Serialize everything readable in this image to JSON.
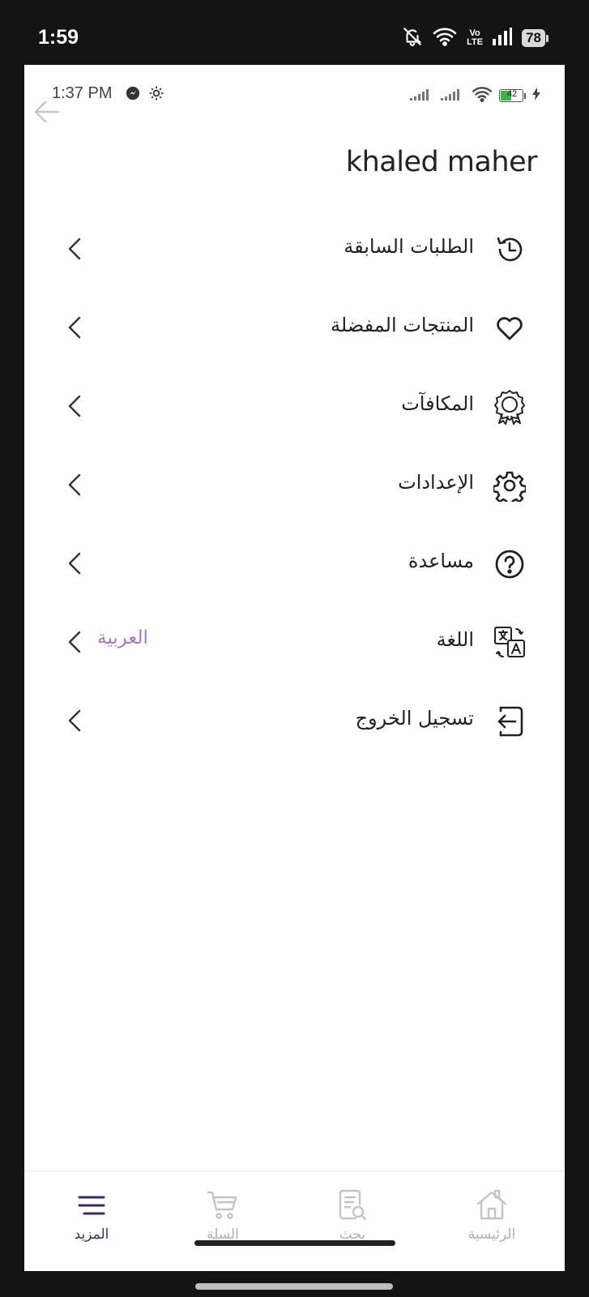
{
  "outer_status": {
    "time": "1:59",
    "network": "Vo\nLTE",
    "battery": "78"
  },
  "inner_status": {
    "time": "1:37 PM",
    "battery": "42"
  },
  "user": {
    "name": "khaled maher"
  },
  "menu": [
    {
      "label": "الطلبات السابقة",
      "icon": "history-icon"
    },
    {
      "label": "المنتجات المفضلة",
      "icon": "heart-icon"
    },
    {
      "label": "المكافآت",
      "icon": "reward-badge-icon"
    },
    {
      "label": "الإعدادات",
      "icon": "gear-icon"
    },
    {
      "label": "مساعدة",
      "icon": "help-icon"
    },
    {
      "label": "اللغة",
      "icon": "translate-icon",
      "value": "العربية"
    },
    {
      "label": "تسجيل الخروج",
      "icon": "logout-icon"
    }
  ],
  "nav": [
    {
      "label": "المزيد",
      "icon": "menu-icon",
      "active": true
    },
    {
      "label": "السلة",
      "icon": "cart-icon",
      "active": false
    },
    {
      "label": "بحث",
      "icon": "search-doc-icon",
      "active": false
    },
    {
      "label": "الرئيسية",
      "icon": "home-icon",
      "active": false
    }
  ],
  "colors": {
    "accent": "#3f2a5e",
    "value_text": "#a27bc9",
    "inactive": "#b0b0b0"
  }
}
